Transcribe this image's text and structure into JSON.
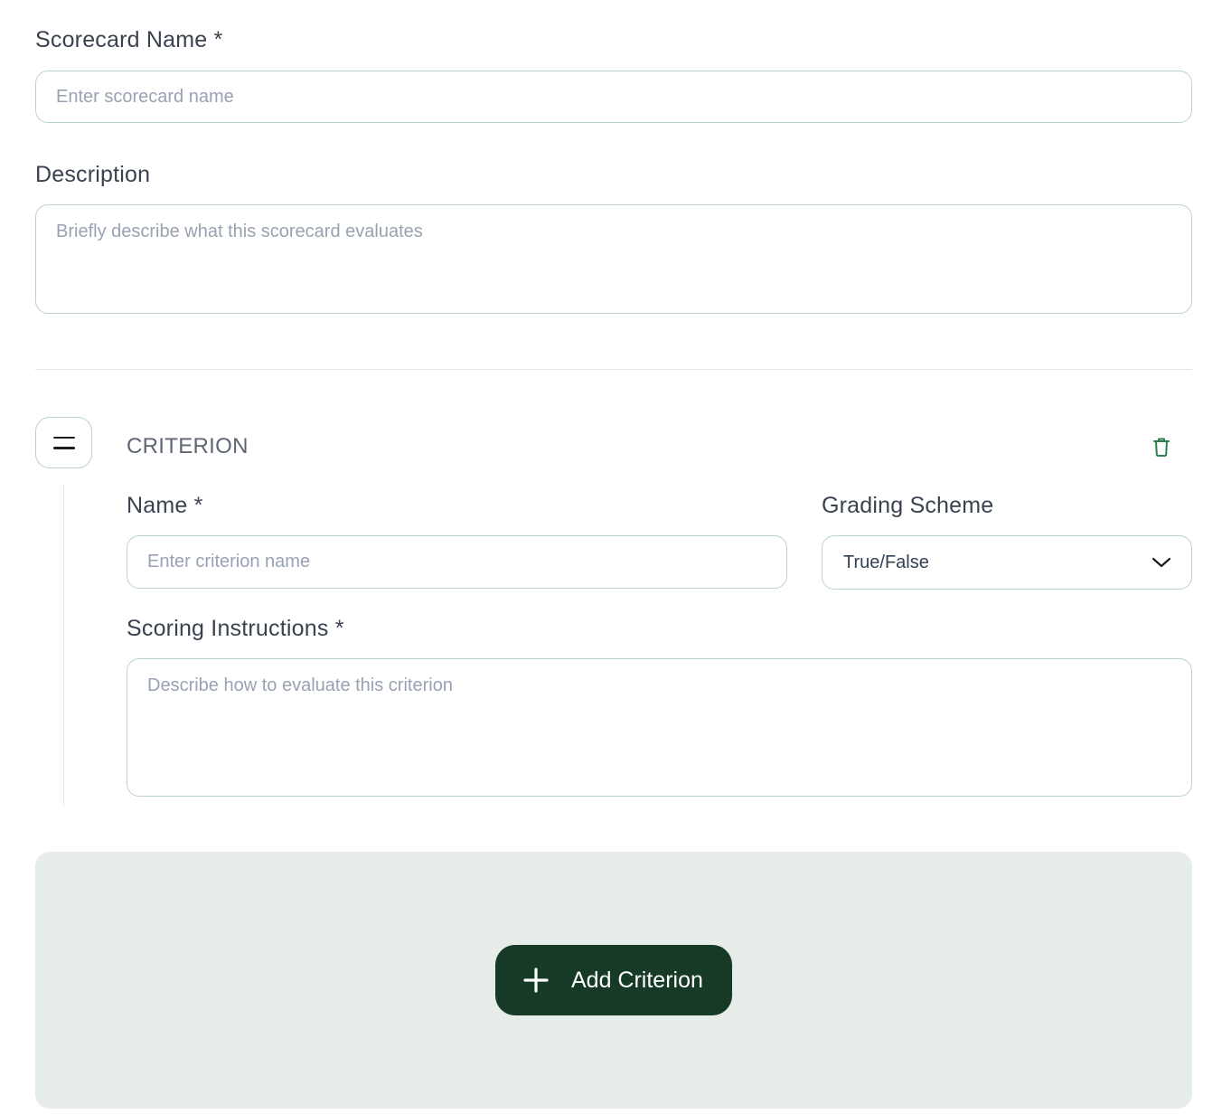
{
  "scorecard": {
    "name_label": "Scorecard Name *",
    "name_placeholder": "Enter scorecard name",
    "description_label": "Description",
    "description_placeholder": "Briefly describe what this scorecard evaluates"
  },
  "criterion": {
    "heading": "CRITERION",
    "name_label": "Name *",
    "name_placeholder": "Enter criterion name",
    "grading_label": "Grading Scheme",
    "grading_value": "True/False",
    "instructions_label": "Scoring Instructions *",
    "instructions_placeholder": "Describe how to evaluate this criterion",
    "icons": {
      "drag": "drag-handle-icon",
      "delete": "trash-icon",
      "dropdown": "chevron-down-icon"
    }
  },
  "add_button": {
    "label": "Add Criterion",
    "icon": "plus-icon"
  },
  "colors": {
    "accent": "#173a26",
    "delete_icon": "#2e7d4a",
    "field_border": "#bcd3c9",
    "add_area_bg": "#e6ece8"
  }
}
